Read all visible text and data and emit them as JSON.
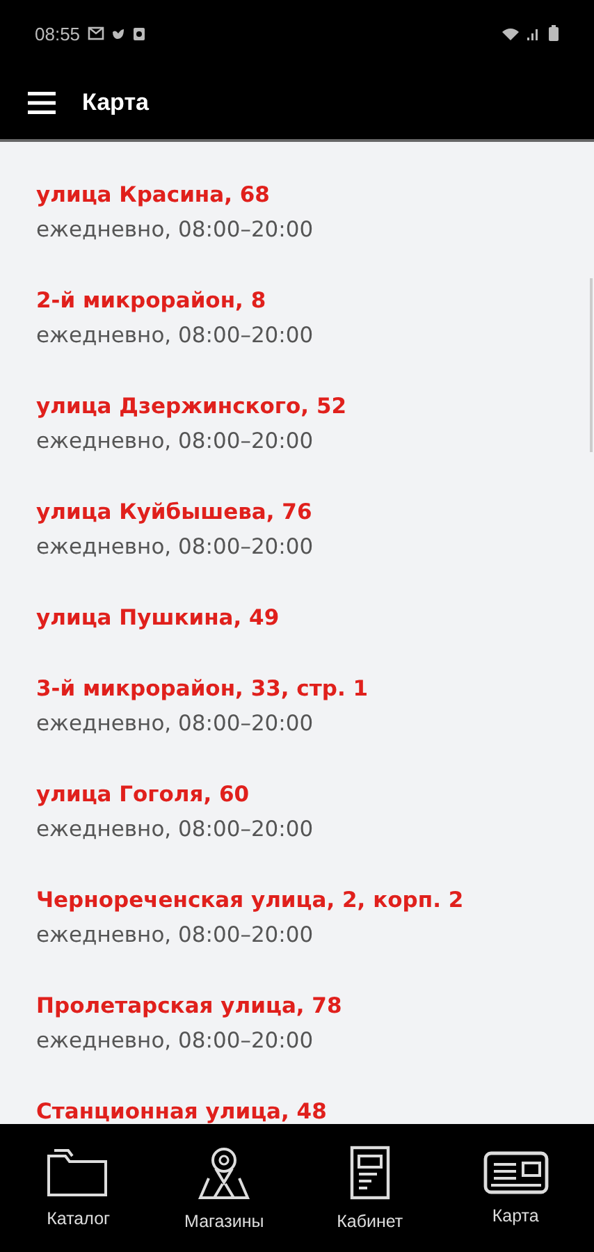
{
  "status_bar": {
    "time": "08:55"
  },
  "header": {
    "title": "Карта"
  },
  "stores": [
    {
      "address": "улица Красина, 68",
      "hours": "ежедневно, 08:00–20:00"
    },
    {
      "address": "2-й микрорайон, 8",
      "hours": "ежедневно, 08:00–20:00"
    },
    {
      "address": "улица Дзержинского, 52",
      "hours": "ежедневно, 08:00–20:00"
    },
    {
      "address": "улица Куйбышева, 76",
      "hours": "ежедневно, 08:00–20:00"
    },
    {
      "address": "улица Пушкина, 49"
    },
    {
      "address": "3-й микрорайон, 33, стр. 1",
      "hours": "ежедневно, 08:00–20:00"
    },
    {
      "address": "улица Гоголя, 60",
      "hours": "ежедневно, 08:00–20:00"
    },
    {
      "address": "Чернореченская улица, 2, корп. 2",
      "hours": "ежедневно, 08:00–20:00"
    },
    {
      "address": "Пролетарская улица, 78",
      "hours": "ежедневно, 08:00–20:00"
    },
    {
      "address": "Станционная улица, 48"
    }
  ],
  "bottom_nav": [
    {
      "label": "Каталог",
      "kind": "folder"
    },
    {
      "label": "Магазины",
      "kind": "map"
    },
    {
      "label": "Кабинет",
      "kind": "document"
    },
    {
      "label": "Карта",
      "kind": "card"
    }
  ]
}
